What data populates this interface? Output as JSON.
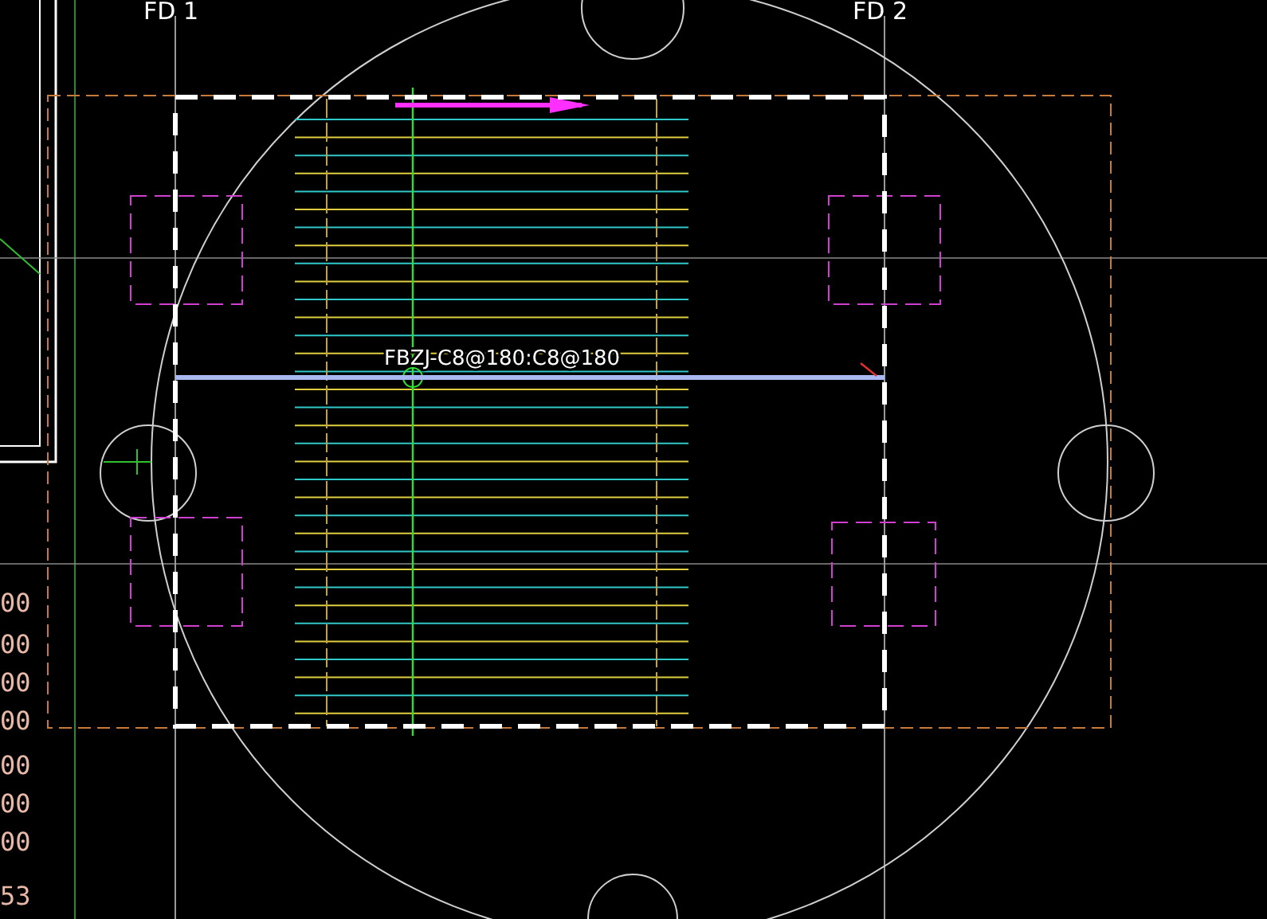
{
  "axis_labels": [
    {
      "text": "FD 1"
    },
    {
      "text": "FD 2"
    }
  ],
  "rebar_label": "FBZJ-C8@180:C8@180",
  "dimension_values": [
    "00",
    "00",
    "00",
    "00",
    "00",
    "00",
    "00",
    "53"
  ]
}
